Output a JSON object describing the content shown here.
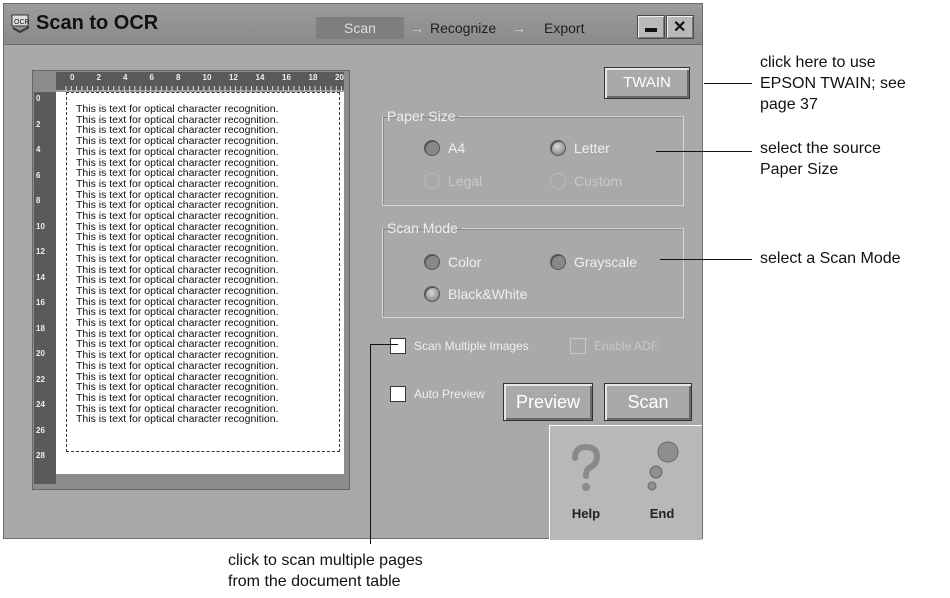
{
  "window": {
    "title": "Scan to OCR",
    "steps": [
      "Scan",
      "Recognize",
      "Export"
    ],
    "arrow": "→",
    "minimize_label": "—",
    "close_label": "✕"
  },
  "preview": {
    "ruler_numbers": [
      "0",
      "2",
      "4",
      "6",
      "8",
      "10",
      "12",
      "14",
      "16",
      "18",
      "20"
    ],
    "left_ruler_numbers": [
      "0",
      "2",
      "4",
      "6",
      "8",
      "10",
      "12",
      "14",
      "16",
      "18",
      "20",
      "22",
      "24",
      "26",
      "28"
    ],
    "ocr_line": "This is text for optical character recognition.",
    "ocr_line_count": 30
  },
  "controls": {
    "twain_label": "TWAIN",
    "paper_size": {
      "legend": "Paper Size",
      "options": [
        {
          "label": "A4",
          "selected": false,
          "enabled": true
        },
        {
          "label": "Letter",
          "selected": true,
          "enabled": true
        },
        {
          "label": "Legal",
          "selected": false,
          "enabled": false
        },
        {
          "label": "Custom",
          "selected": false,
          "enabled": false
        }
      ]
    },
    "scan_mode": {
      "legend": "Scan Mode",
      "options": [
        {
          "label": "Color",
          "selected": false
        },
        {
          "label": "Grayscale",
          "selected": false
        },
        {
          "label": "Black&White",
          "selected": true
        }
      ]
    },
    "scan_multiple_label": "Scan Multiple Images",
    "enable_adf_label": "Enable ADF",
    "auto_preview_label": "Auto Preview",
    "preview_button": "Preview",
    "scan_button": "Scan",
    "help_label": "Help",
    "end_label": "End"
  },
  "callouts": {
    "twain": [
      "click here to use",
      "EPSON TWAIN; see",
      "page 37"
    ],
    "paper": [
      "select the source",
      "Paper Size"
    ],
    "mode": [
      "select a Scan Mode"
    ],
    "multiple": [
      "click to scan multiple pages",
      "from the document table"
    ]
  }
}
